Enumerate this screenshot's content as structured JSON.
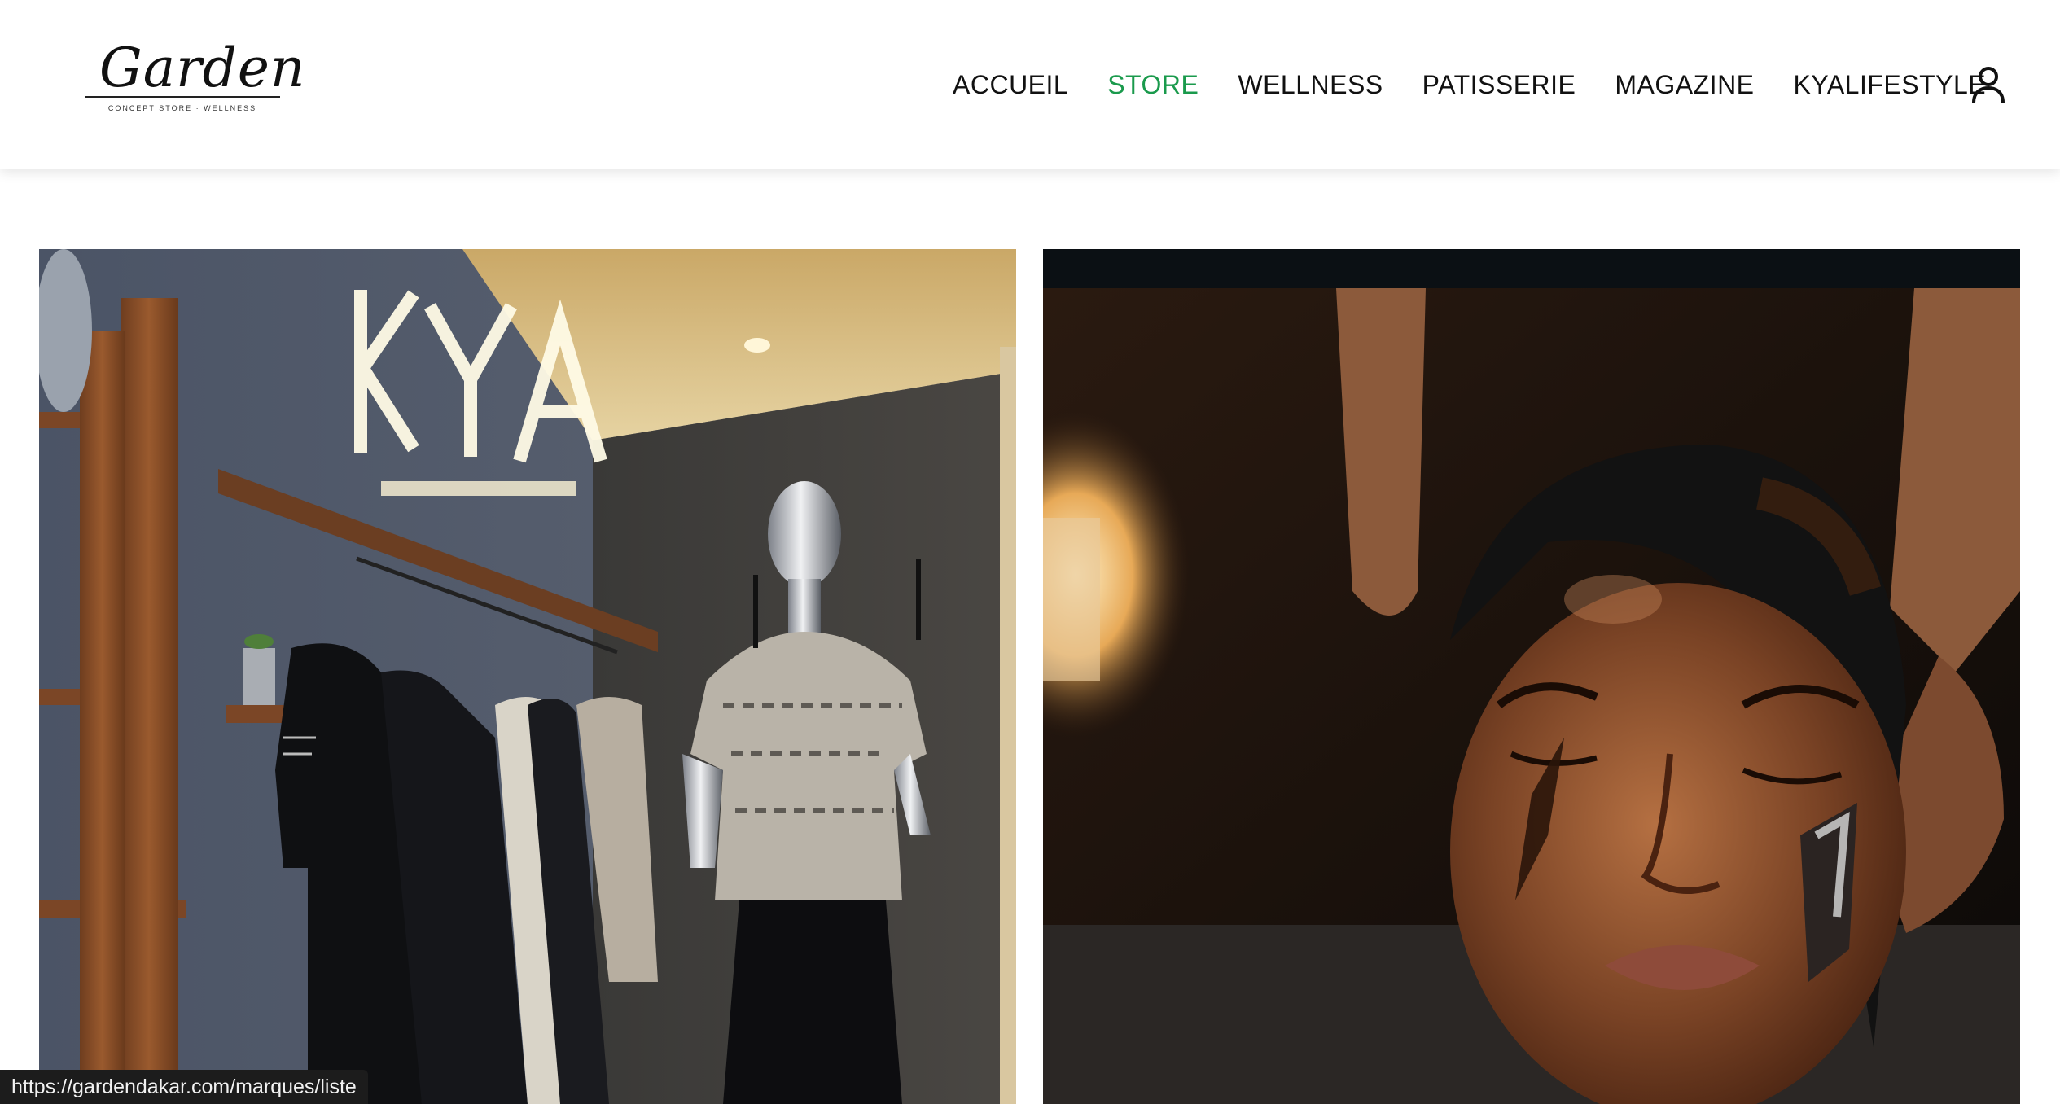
{
  "header": {
    "logo": {
      "wordmark": "Garden",
      "tagline": "CONCEPT STORE · WELLNESS"
    },
    "nav": [
      {
        "label": "ACCUEIL",
        "active": false
      },
      {
        "label": "STORE",
        "active": true
      },
      {
        "label": "WELLNESS",
        "active": false
      },
      {
        "label": "PATISSERIE",
        "active": false
      },
      {
        "label": "MAGAZINE",
        "active": false
      },
      {
        "label": "KYALIFESTYLE",
        "active": false
      }
    ],
    "account_icon": "user-icon"
  },
  "cards": [
    {
      "name": "store-photo",
      "sign_text": "KYA"
    },
    {
      "name": "wellness-photo"
    }
  ],
  "status_bar": {
    "url": "https://gardendakar.com/marques/liste"
  },
  "colors": {
    "accent": "#1a9a4c",
    "text": "#111111",
    "background": "#ffffff"
  }
}
